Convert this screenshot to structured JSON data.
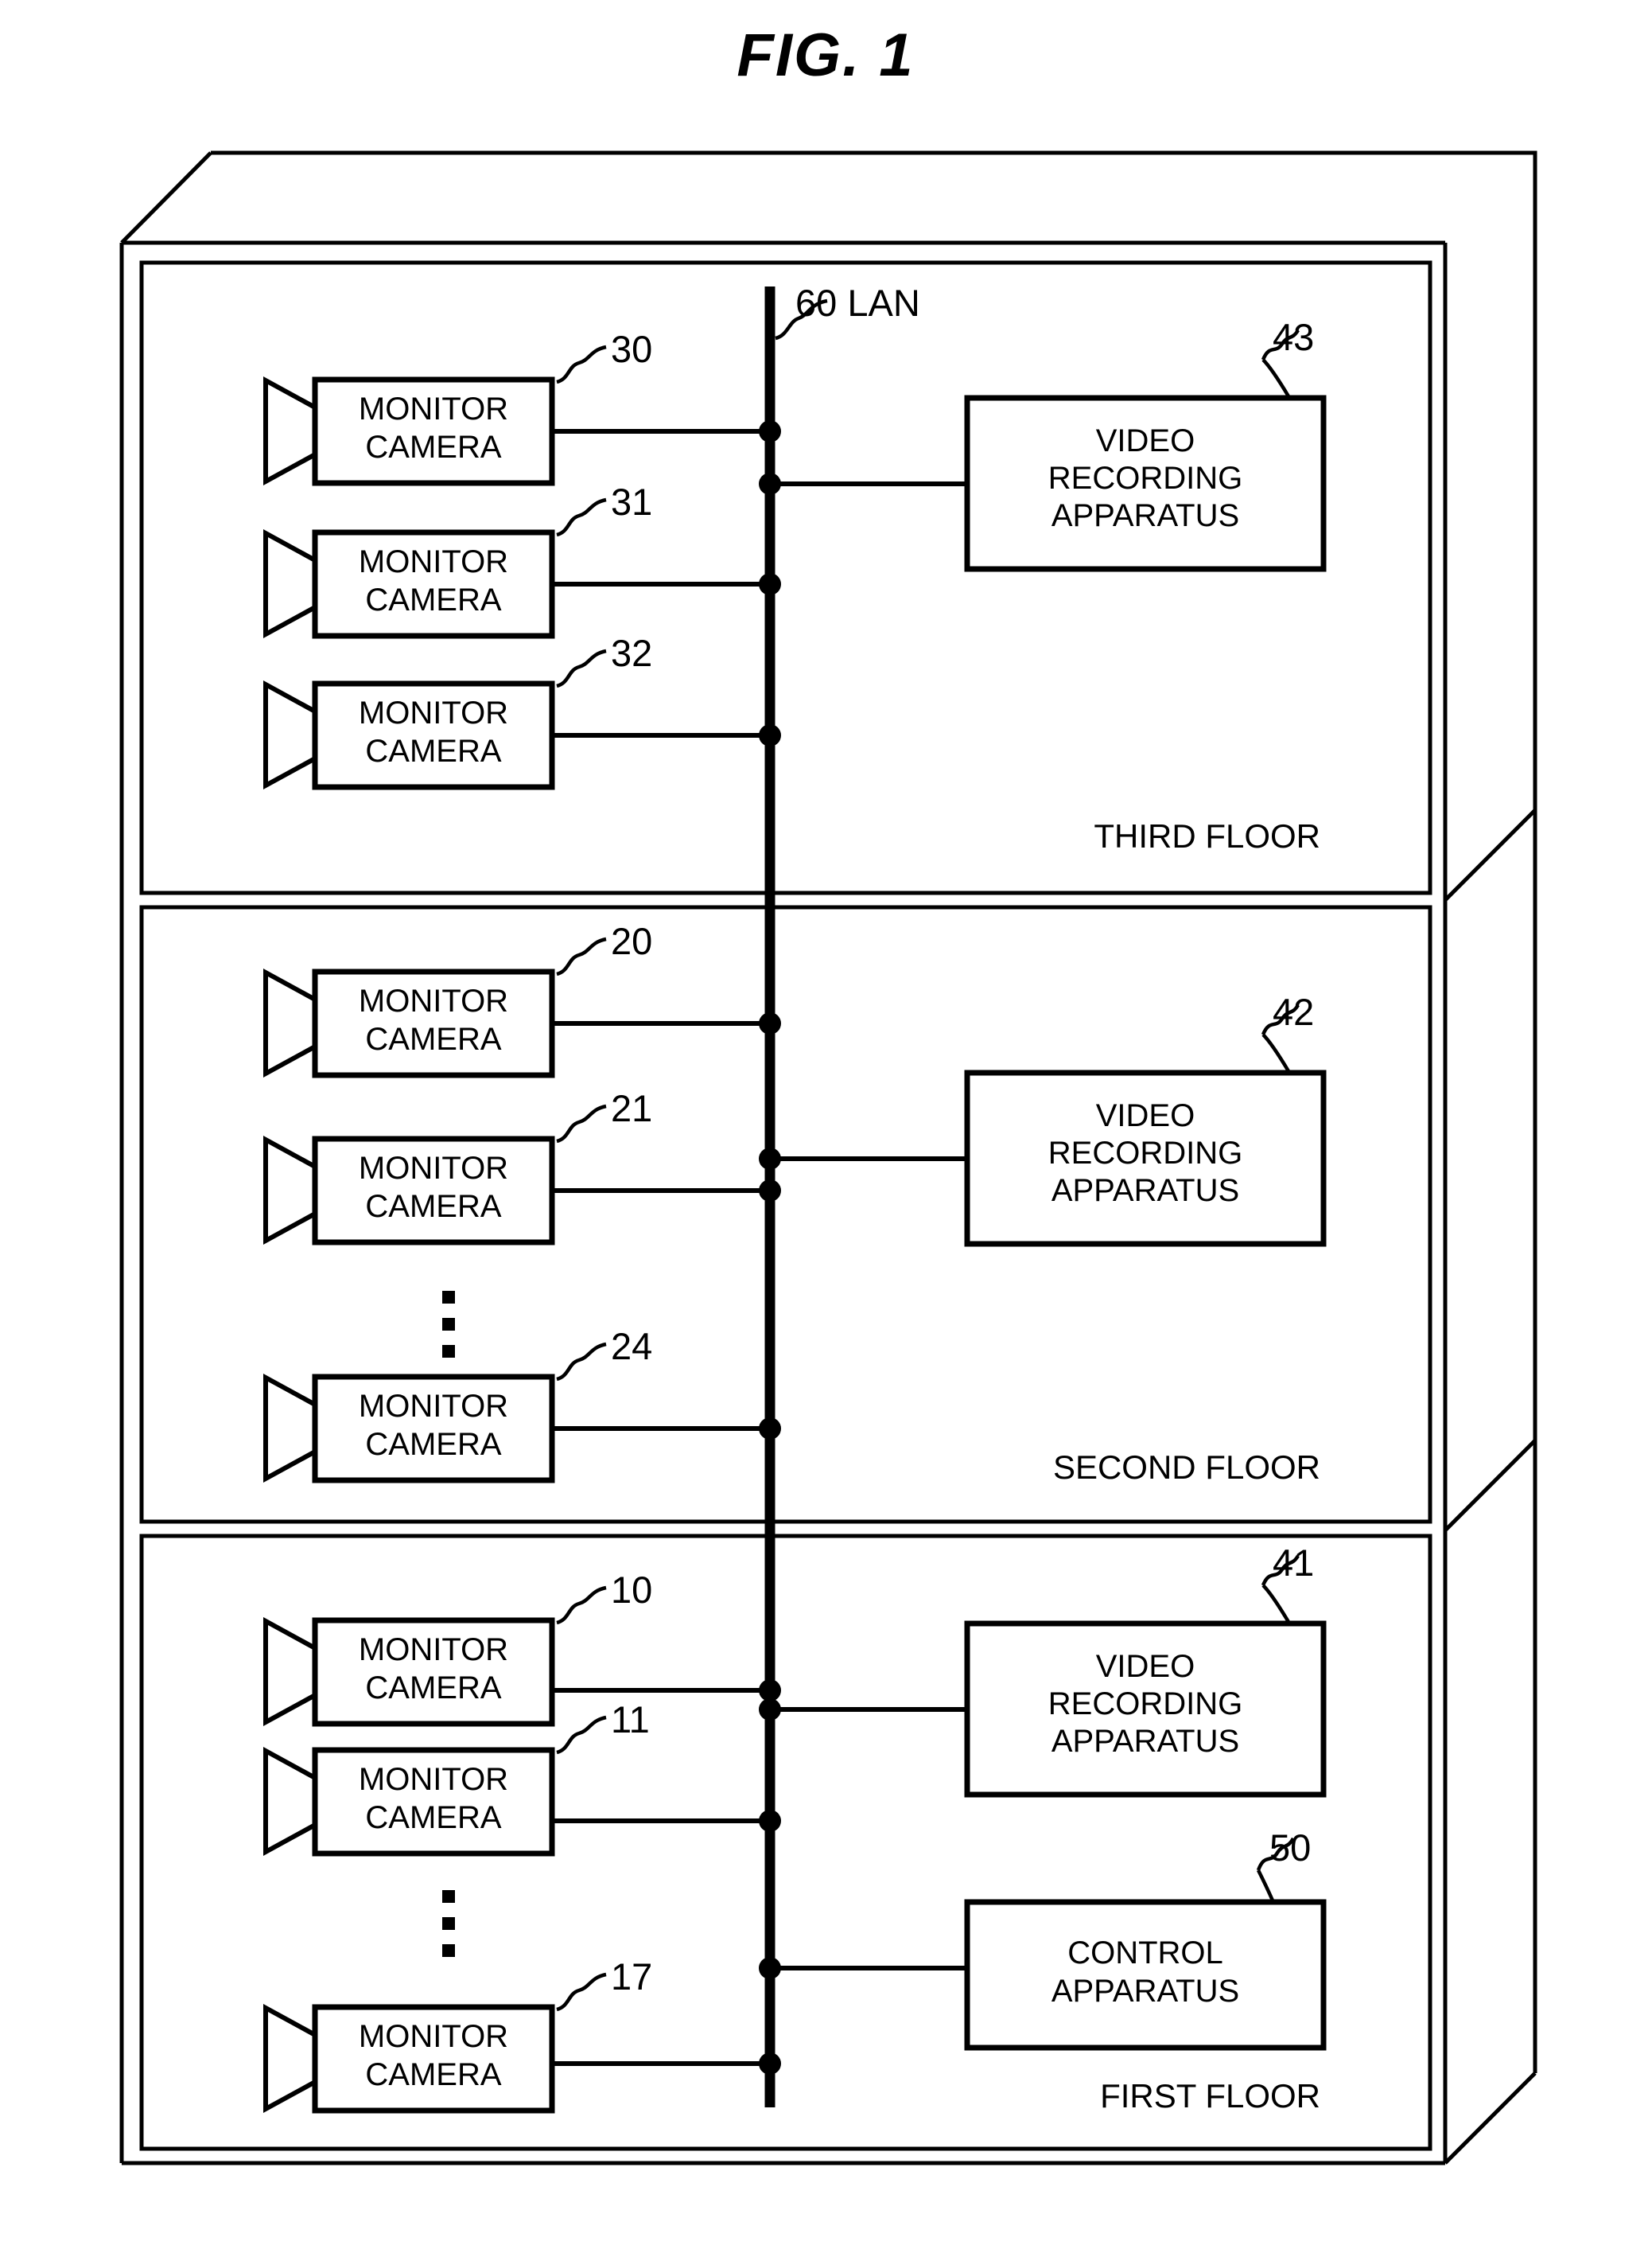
{
  "figure": {
    "title": "FIG. 1"
  },
  "network": {
    "bus_ref": "60",
    "bus_label": "LAN",
    "bus_caption": "60  LAN"
  },
  "floors": [
    {
      "id": "third-floor",
      "name": "THIRD FLOOR",
      "cameras": [
        {
          "ref": "30",
          "label_line1": "MONITOR",
          "label_line2": "CAMERA"
        },
        {
          "ref": "31",
          "label_line1": "MONITOR",
          "label_line2": "CAMERA"
        },
        {
          "ref": "32",
          "label_line1": "MONITOR",
          "label_line2": "CAMERA"
        }
      ],
      "has_ellipsis": false,
      "devices": [
        {
          "ref": "43",
          "kind": "video-recording-apparatus",
          "label_line1": "VIDEO",
          "label_line2": "RECORDING",
          "label_line3": "APPARATUS"
        }
      ]
    },
    {
      "id": "second-floor",
      "name": "SECOND FLOOR",
      "cameras": [
        {
          "ref": "20",
          "label_line1": "MONITOR",
          "label_line2": "CAMERA"
        },
        {
          "ref": "21",
          "label_line1": "MONITOR",
          "label_line2": "CAMERA"
        },
        {
          "ref": "24",
          "label_line1": "MONITOR",
          "label_line2": "CAMERA"
        }
      ],
      "has_ellipsis": true,
      "devices": [
        {
          "ref": "42",
          "kind": "video-recording-apparatus",
          "label_line1": "VIDEO",
          "label_line2": "RECORDING",
          "label_line3": "APPARATUS"
        }
      ]
    },
    {
      "id": "first-floor",
      "name": "FIRST FLOOR",
      "cameras": [
        {
          "ref": "10",
          "label_line1": "MONITOR",
          "label_line2": "CAMERA"
        },
        {
          "ref": "11",
          "label_line1": "MONITOR",
          "label_line2": "CAMERA"
        },
        {
          "ref": "17",
          "label_line1": "MONITOR",
          "label_line2": "CAMERA"
        }
      ],
      "has_ellipsis": true,
      "devices": [
        {
          "ref": "41",
          "kind": "video-recording-apparatus",
          "label_line1": "VIDEO",
          "label_line2": "RECORDING",
          "label_line3": "APPARATUS"
        },
        {
          "ref": "50",
          "kind": "control-apparatus",
          "label_line1": "CONTROL",
          "label_line2": "APPARATUS",
          "label_line3": ""
        }
      ]
    }
  ],
  "colors": {
    "ink": "#000000",
    "paper": "#ffffff"
  }
}
